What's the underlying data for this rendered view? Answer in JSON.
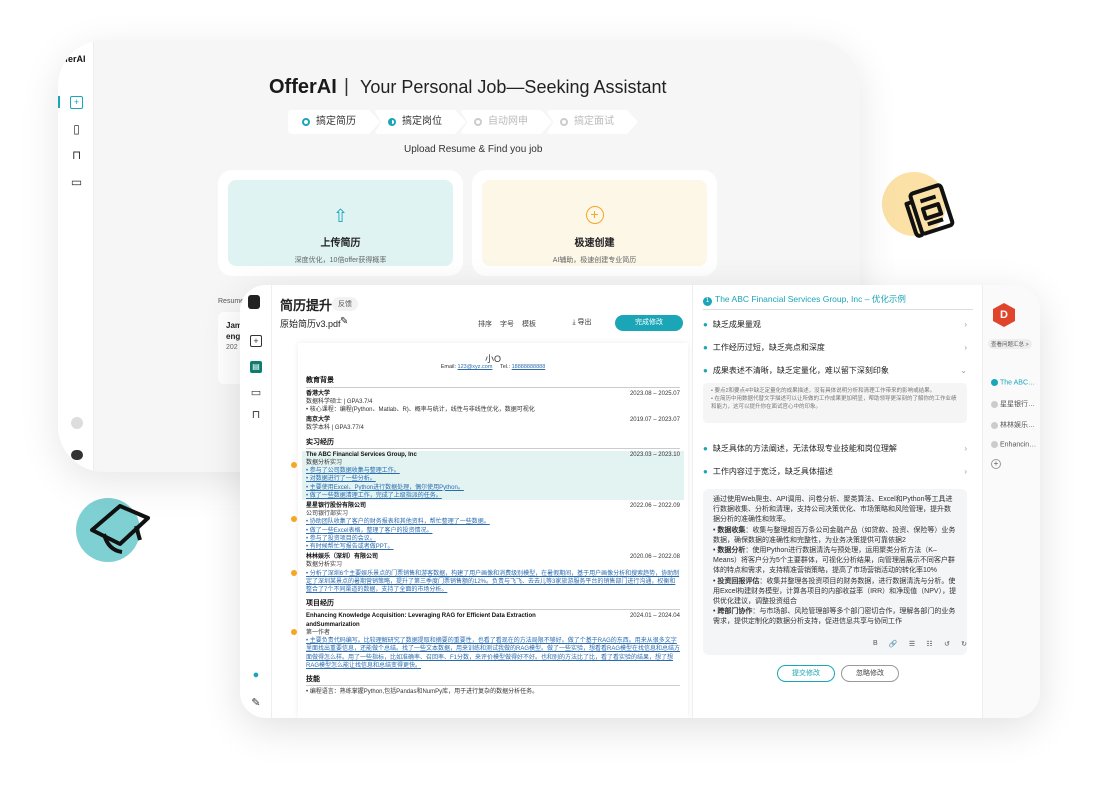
{
  "brand": {
    "name": "OfferAI",
    "divider": "|",
    "tagline": "Your Personal Job—Seeking Assistant",
    "sidebar_logo": "fferAI"
  },
  "steps": [
    {
      "label": "搞定简历",
      "state": "active"
    },
    {
      "label": "搞定岗位",
      "state": "half"
    },
    {
      "label": "自动网申",
      "state": "disabled"
    },
    {
      "label": "搞定面试",
      "state": "disabled"
    }
  ],
  "upload_caption": "Upload Resume & Find you job",
  "cards": {
    "upload": {
      "title": "上传简历",
      "subtitle": "深度优化，10倍offer获得概率",
      "icon": "upload-icon"
    },
    "create": {
      "title": "极速创建",
      "subtitle": "AI辅助，极速创建专业简历",
      "icon": "plus-circle-icon"
    }
  },
  "back_list": {
    "label": "Resume1",
    "item_title_1": "Jam",
    "item_title_2": "eng",
    "item_date": "202"
  },
  "front": {
    "title": "简历提升",
    "feedback": "反馈",
    "filename": "原始简历v3.pdf",
    "toolbar": {
      "sort": "排序",
      "font": "字号",
      "template": "模板",
      "export": "导出",
      "finish": "完成修改"
    }
  },
  "resume": {
    "name": "小O",
    "email_label": "Email:",
    "email": "123@xyz.com",
    "tel_label": "Tel.:",
    "tel": "18888888888",
    "education_title": "教育背景",
    "education": [
      {
        "school": "香港大学",
        "date": "2023.08 – 2025.07",
        "major": "数据科学硕士 | GPA3.7/4",
        "course": "• 核心课程：编程(Python、Matlab、R)、概率与统计，线性与非线性优化，数据可视化"
      },
      {
        "school": "南京大学",
        "date": "2019.07 – 2023.07",
        "major": "数学本科 | GPA3.77/4",
        "course": ""
      }
    ],
    "intern_title": "实习经历",
    "interns": [
      {
        "company": "The ABC Financial Services Group, Inc",
        "date": "2023.03 – 2023.10",
        "role": "数据分析实习",
        "highlight": true,
        "bullets": [
          "参与了公司数据收集与整理工作。",
          "对数据进行了一些分析。",
          "主要使用Excel、Python进行数据处理，偶尔使用Python。",
          "做了一些数据清理工作，完成了上级指派的任务。"
        ]
      },
      {
        "company": "星星银行股份有限公司",
        "date": "2022.06 – 2022.09",
        "role": "公司银行部实习",
        "highlight": false,
        "bullets": [
          "协助团队收集了客户的财务报表和其他资料，帮忙整理了一些数据。",
          "做了一些Excel表格，整理了客户的投资情况。",
          "参与了投资项目的会议。",
          "有时候帮忙写报告或者做PPT。"
        ]
      },
      {
        "company": "林林娱乐（深圳）有限公司",
        "date": "2020.06 – 2022.08",
        "role": "数据分析实习",
        "highlight": false,
        "bullets": [
          "分析了深圳6个主要娱乐景点的门票销售和游客数据，构建了用户画像和消费级别模型，在暑假期间，基于用户画像分析和搜索趋势，协助制定了深圳某景点的暑期营销策略，提升了第三季度门票销售额的12%。负责与飞飞、去去儿等3家旅游服务平台的销售部门进行沟通，权衡和整合了7个不同渠道的数据，支持了全面的市场分析。"
        ]
      }
    ],
    "project_title": "项目经历",
    "project": {
      "name": "Enhancing Knowledge Acquisition: Leveraging RAG for Efficient Data Extraction",
      "name2": "andSummarization",
      "date": "2024.01 – 2024.04",
      "role": "第一作者",
      "bullet": "主要负责代码编写。比较理解研究了数据提取和摘要的重要性，也看了看现在的方法局限不够好。做了个基于RAG的东西。用来从很多文字里面找出重要信息，还能做个总结。找了一些文本数据，用来训练和测试我做的RAG模型。做了一些实验，想看看RAG模型在找信息和总结方面做得怎么样。用了一些指标，比如准确率、召回率、F1分数，来评价模型做得好不好。也和别的方法比了比，看了看实验的结果，想了想RAG模型怎么能让找信息和总结变得更快。"
    },
    "skills_title": "技能",
    "skills": "• 编程语言：熟练掌握Python,包括Pandas和NumPy库，用于进行复杂的数据分析任务。"
  },
  "panel": {
    "header": "The ABC Financial Services Group, Inc – 优化示例",
    "issues": [
      {
        "label": "缺乏成果量观",
        "expanded": false
      },
      {
        "label": "工作经历过短，缺乏亮点和深度",
        "expanded": false
      },
      {
        "label": "成果表述不清晰，缺乏定量化，难以留下深刻印象",
        "expanded": true
      },
      {
        "label": "缺乏具体的方法阐述，无法体现专业技能和岗位理解",
        "expanded": false
      },
      {
        "label": "工作内容过于宽泛，缺乏具体描述",
        "expanded": false
      }
    ],
    "expanded_notes": [
      "要点2和要点4中缺乏定量化的成果描述，没有具体说明分析和清理工作带来的影响或结果。",
      "在简历中用数据代替文字描述可以让所做的工作成果更加明显，帮助领导更深刻的了解你的工作业绩和能力，这可以提升你在面试官心中的印象。"
    ],
    "suggestion_intro": "通过使用Web爬虫、API调用、问卷分析、聚类算法、Excel和Python等工具进行数据收集、分析和清理，支持公司决策优化、市场策略和风险管理，提升数据分析的准确性和效率。",
    "suggestion_points": [
      {
        "key": "数据收集",
        "text": "：收集与整理超百万条公司金融产品（如贷款、投资、保险等）业务数据，确保数据的准确性和完整性，为业务决策提供可靠依据2"
      },
      {
        "key": "数据分析",
        "text": "：使用Python进行数据清洗与预处理，运用聚类分析方法（K–Means）将客户分为5个主要群体，可视化分析结果，向管理层展示不同客户群体的特点和需求，支持精准营销策略，提高了市场营销活动的转化率10%"
      },
      {
        "key": "投资回报评估",
        "text": "：收集并整理各投资项目的财务数据，进行数据清洗与分析。使用Excel构建财务模型，计算各项目的内部收益率（IRR）和净现值（NPV），提供优化建议，调整投资组合"
      },
      {
        "key": "跨部门协作",
        "text": "：与市场部、风险管理部等多个部门密切合作，理解各部门的业务需求，提供定制化的数据分析支持，促进信息共享与协同工作"
      }
    ],
    "editor_tools": [
      "B",
      "🔗",
      "☰",
      "☷",
      "↺",
      "↻"
    ],
    "submit": "提交修改",
    "ignore": "忽略修改"
  },
  "history": {
    "avatar": "D",
    "summary": "查看问题汇总 >",
    "items": [
      "The ABC…",
      "星星银行…",
      "林林娱乐…",
      "Enhancin…"
    ],
    "add": "+"
  },
  "colors": {
    "accent": "#1aa6b7",
    "upload_bg": "#dff3f3",
    "create_bg": "#fdf7e8",
    "orange": "#f5a623",
    "deco_yellow": "#fbe1a6",
    "deco_teal": "#7fd0d3",
    "avatar_red": "#e0442b"
  }
}
